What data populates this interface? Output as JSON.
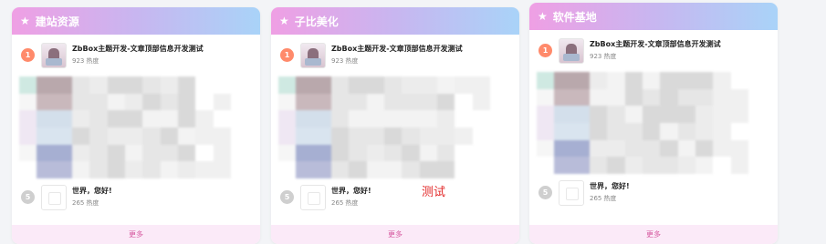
{
  "cards": [
    {
      "title": "建站资源",
      "items": [
        {
          "rank": "1",
          "title": "ZbBox主题开发-文章顶部信息开发测试",
          "heat": "923",
          "heat_unit": "热度"
        },
        {
          "rank": "5",
          "title": "世界，您好!",
          "heat": "265",
          "heat_unit": "热度"
        }
      ],
      "more_label": "更多"
    },
    {
      "title": "子比美化",
      "items": [
        {
          "rank": "1",
          "title": "ZbBox主题开发-文章顶部信息开发测试",
          "heat": "923",
          "heat_unit": "热度"
        },
        {
          "rank": "5",
          "title": "世界，您好!",
          "heat": "265",
          "heat_unit": "热度"
        }
      ],
      "more_label": "更多"
    },
    {
      "title": "软件基地",
      "items": [
        {
          "rank": "1",
          "title": "ZbBox主题开发-文章顶部信息开发测试",
          "heat": "923",
          "heat_unit": "热度"
        },
        {
          "rank": "5",
          "title": "世界，您好!",
          "heat": "265",
          "heat_unit": "热度"
        }
      ],
      "more_label": "更多"
    }
  ],
  "floating_text": "测试",
  "colors": {
    "header_gradient": [
      "#ef9fe4",
      "#c8b6f0",
      "#a9d3f8"
    ],
    "rank_1": "#ff8a6b",
    "rank_5": "#cfcfcf",
    "more_bg": "#fbeaf8",
    "more_text": "#d6589f",
    "floating_text": "#e22828"
  },
  "icons": {
    "header": "star-icon"
  }
}
